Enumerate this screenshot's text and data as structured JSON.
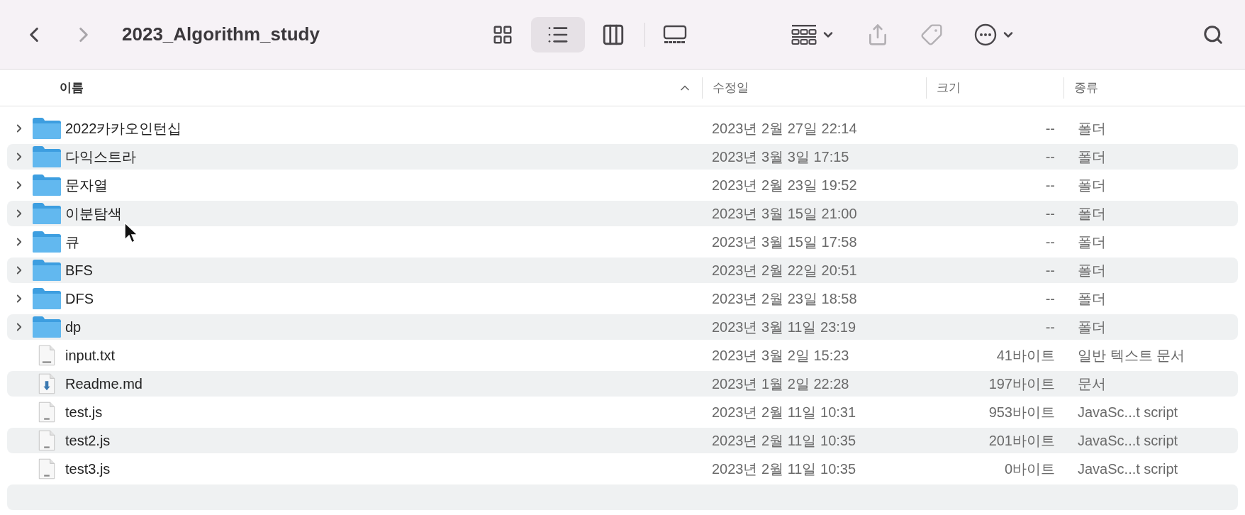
{
  "toolbar": {
    "title": "2023_Algorithm_study",
    "back": {
      "disabled": false
    },
    "forward": {
      "disabled": true
    },
    "view_modes": [
      {
        "kind": "icons",
        "selected": false
      },
      {
        "kind": "list",
        "selected": true
      },
      {
        "kind": "columns",
        "selected": false
      },
      {
        "kind": "gallery",
        "selected": false
      }
    ],
    "actions": [
      {
        "kind": "group",
        "disabled": false
      },
      {
        "kind": "share",
        "disabled": true
      },
      {
        "kind": "tag",
        "disabled": true
      },
      {
        "kind": "more",
        "disabled": false
      },
      {
        "kind": "search",
        "disabled": false
      }
    ]
  },
  "columns": [
    {
      "label": "이름",
      "sorted": true
    },
    {
      "label": "수정일",
      "sorted": false
    },
    {
      "label": "크기",
      "sorted": false
    },
    {
      "label": "종류",
      "sorted": false
    }
  ],
  "rows": [
    {
      "kind": "folder",
      "name": "2022카카오인턴십",
      "modified": "2023년 2월 27일 22:14",
      "size": "--",
      "type": "폴더"
    },
    {
      "kind": "folder",
      "name": "다익스트라",
      "modified": "2023년 3월 3일 17:15",
      "size": "--",
      "type": "폴더"
    },
    {
      "kind": "folder",
      "name": "문자열",
      "modified": "2023년 2월 23일 19:52",
      "size": "--",
      "type": "폴더"
    },
    {
      "kind": "folder",
      "name": "이분탐색",
      "modified": "2023년 3월 15일 21:00",
      "size": "--",
      "type": "폴더"
    },
    {
      "kind": "folder",
      "name": "큐",
      "modified": "2023년 3월 15일 17:58",
      "size": "--",
      "type": "폴더"
    },
    {
      "kind": "folder",
      "name": "BFS",
      "modified": "2023년 2월 22일 20:51",
      "size": "--",
      "type": "폴더"
    },
    {
      "kind": "folder",
      "name": "DFS",
      "modified": "2023년 2월 23일 18:58",
      "size": "--",
      "type": "폴더"
    },
    {
      "kind": "folder",
      "name": "dp",
      "modified": "2023년 3월 11일 23:19",
      "size": "--",
      "type": "폴더"
    },
    {
      "kind": "text",
      "name": "input.txt",
      "modified": "2023년 3월 2일 15:23",
      "size": "41바이트",
      "type": "일반 텍스트 문서"
    },
    {
      "kind": "markdown",
      "name": "Readme.md",
      "modified": "2023년 1월 2일 22:28",
      "size": "197바이트",
      "type": "문서"
    },
    {
      "kind": "script",
      "name": "test.js",
      "modified": "2023년 2월 11일 10:31",
      "size": "953바이트",
      "type": "JavaSc...t script"
    },
    {
      "kind": "script",
      "name": "test2.js",
      "modified": "2023년 2월 11일 10:35",
      "size": "201바이트",
      "type": "JavaSc...t script"
    },
    {
      "kind": "script",
      "name": "test3.js",
      "modified": "2023년 2월 11일 10:35",
      "size": "0바이트",
      "type": "JavaSc...t script"
    }
  ]
}
